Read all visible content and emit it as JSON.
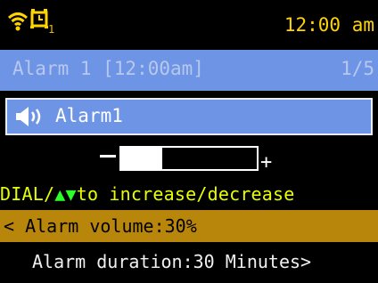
{
  "status_bar": {
    "alarm_index": "1",
    "time": "12:00 am",
    "icons": [
      "wifi-icon",
      "alarm-clock-icon"
    ]
  },
  "header": {
    "title": "Alarm 1 [12:00am]",
    "page": "1/5"
  },
  "alarm": {
    "name": "Alarm1",
    "icon": "speaker-icon"
  },
  "volume_slider": {
    "minus": "−",
    "plus": "+",
    "level_percent": 30
  },
  "hint": {
    "prefix": "DIAL/",
    "arrows": "▲▼",
    "suffix": "to increase/decrease"
  },
  "menu": {
    "selected": "< Alarm volume:30%",
    "next": "Alarm duration:30 Minutes>"
  },
  "colors": {
    "header_blue": "#6e94e6",
    "clock_yellow": "#ffd400",
    "hint_yellow": "#e8ff00",
    "hint_green": "#2aff2a",
    "selected_row": "#b8860b"
  }
}
